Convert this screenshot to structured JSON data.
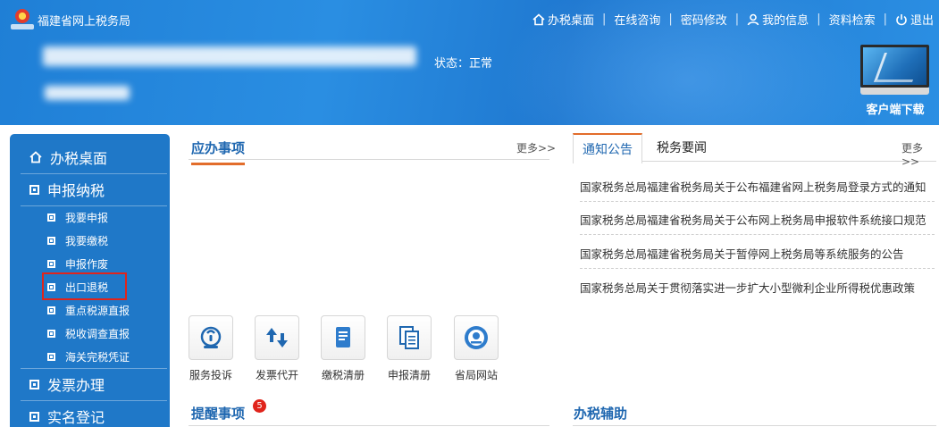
{
  "header": {
    "site_title": "福建省网上税务局",
    "status": "状态：正常",
    "client_download": "客户端下载",
    "nav": [
      {
        "label": "办税桌面",
        "icon": "home-icon"
      },
      {
        "label": "在线咨询"
      },
      {
        "label": "密码修改"
      },
      {
        "label": "我的信息",
        "icon": "user-icon"
      },
      {
        "label": "资料检索"
      },
      {
        "label": "退出",
        "icon": "power-icon"
      }
    ],
    "separator": "|"
  },
  "sidebar": {
    "items": [
      {
        "label": "办税桌面",
        "icon": "home-icon"
      },
      {
        "label": "申报纳税",
        "icon": "square-bullet-icon"
      },
      {
        "label": "我要申报"
      },
      {
        "label": "我要缴税"
      },
      {
        "label": "申报作废"
      },
      {
        "label": "出口退税"
      },
      {
        "label": "重点税源直报"
      },
      {
        "label": "税收调查直报"
      },
      {
        "label": "海关完税凭证"
      },
      {
        "label": "发票办理",
        "icon": "square-bullet-icon"
      },
      {
        "label": "实名登记",
        "icon": "square-bullet-icon"
      }
    ]
  },
  "todo_panel": {
    "title": "应办事项",
    "more": "更多>>"
  },
  "apps": [
    {
      "label": "服务投诉",
      "icon": "phone-service-icon"
    },
    {
      "label": "发票代开",
      "icon": "arrows-icon"
    },
    {
      "label": "缴税清册",
      "icon": "document-icon"
    },
    {
      "label": "申报清册",
      "icon": "stacked-document-icon"
    },
    {
      "label": "省局网站",
      "icon": "tax-emblem-icon"
    }
  ],
  "reminder_panel": {
    "title": "提醒事项",
    "badge": "5"
  },
  "notice_panel": {
    "tabs": [
      "通知公告",
      "税务要闻"
    ],
    "more": "更多>>",
    "items": [
      "国家税务总局福建省税务局关于公布福建省网上税务局登录方式的通知",
      "国家税务总局福建省税务局关于公布网上税务局申报软件系统接口规范",
      "国家税务总局福建省税务局关于暂停网上税务局等系统服务的公告",
      "国家税务总局关于贯彻落实进一步扩大小型微利企业所得税优惠政策"
    ]
  },
  "assist_panel": {
    "title": "办税辅助"
  },
  "colors": {
    "header_blue": "#2a8ee2",
    "sidebar_blue": "#1f78c8",
    "accent_orange": "#e26d2b",
    "title_blue": "#1f67b0",
    "highlight_red": "#e0241b"
  }
}
